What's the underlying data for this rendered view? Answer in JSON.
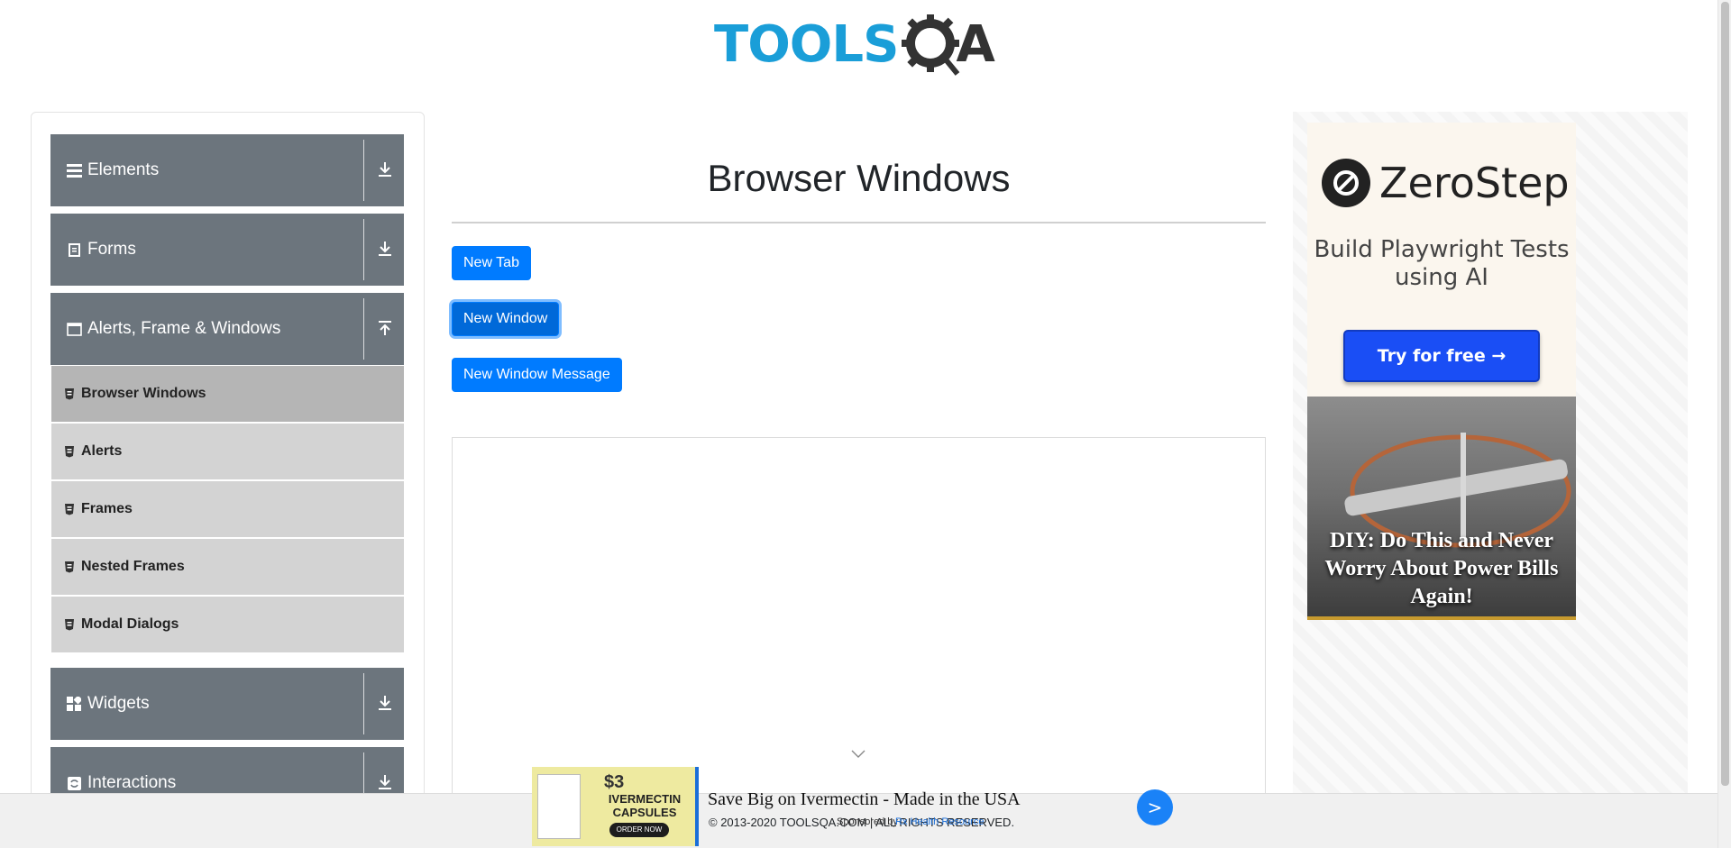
{
  "header": {
    "logo_tools": "TOOLS",
    "logo_a": "A"
  },
  "sidebar": {
    "groups": [
      {
        "label": "Elements",
        "icon": "hamburger-icon"
      },
      {
        "label": "Forms",
        "icon": "form-icon"
      },
      {
        "label": "Alerts, Frame & Windows",
        "icon": "window-icon",
        "expanded": true
      },
      {
        "label": "Widgets",
        "icon": "widgets-icon"
      },
      {
        "label": "Interactions",
        "icon": "interactions-icon"
      }
    ],
    "alerts_items": [
      {
        "label": "Browser Windows",
        "active": true
      },
      {
        "label": "Alerts"
      },
      {
        "label": "Frames"
      },
      {
        "label": "Nested Frames"
      },
      {
        "label": "Modal Dialogs"
      }
    ]
  },
  "main": {
    "title": "Browser Windows",
    "buttons": {
      "new_tab": "New Tab",
      "new_window": "New Window",
      "new_window_message": "New Window Message"
    }
  },
  "right_ad": {
    "brand": "ZeroStep",
    "tagline": "Build Playwright Tests using AI",
    "cta": "Try for free →",
    "story_caption": "DIY: Do This and Never Worry About Power Bills Again!"
  },
  "bottom_ad": {
    "price": "$3",
    "product": "IVERMECTIN CAPSULES",
    "order": "ORDER NOW",
    "headline": "Save Big on Ivermectin - Made in the USA",
    "sponsored": "Sponsored by",
    "sponsor_name": "Rx Health Resource",
    "next_label": ">"
  },
  "footer": {
    "copyright": "© 2013-2020 TOOLSQA.COM | ALL RIGHTS RESERVED."
  },
  "colors": {
    "primary": "#007bff",
    "sidebar_header": "#6c757d",
    "sidebar_item": "#d3d3d3",
    "logo_blue": "#1a9ed8"
  }
}
